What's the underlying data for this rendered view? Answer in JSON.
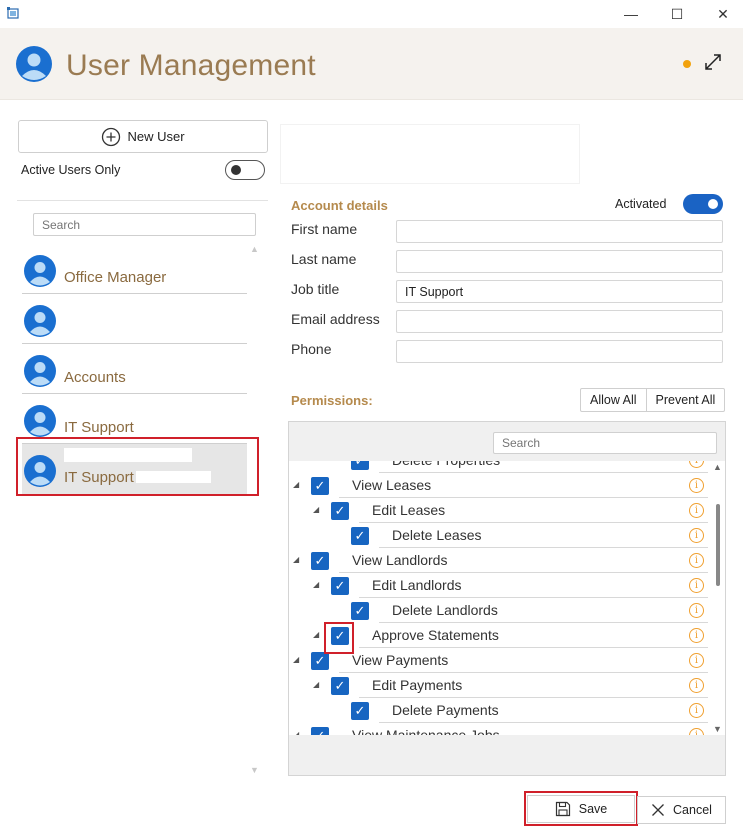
{
  "window": {
    "icon": "app-window-icon",
    "minimize": "—",
    "maximize": "☐",
    "close": "✕"
  },
  "header": {
    "title": "User Management",
    "status_color": "#f2a20c"
  },
  "left": {
    "new_user_label": "New User",
    "active_only_label": "Active Users Only",
    "search_placeholder": "Search",
    "users": [
      {
        "role": "Office Manager"
      },
      {
        "role": ""
      },
      {
        "role": "Accounts"
      },
      {
        "role": "IT Support"
      },
      {
        "role": "IT Support",
        "selected": true
      }
    ]
  },
  "account": {
    "section_title": "Account details",
    "activated_label": "Activated",
    "fields": [
      {
        "label": "First name",
        "value": ""
      },
      {
        "label": "Last name",
        "value": ""
      },
      {
        "label": "Job title",
        "value": "IT Support"
      },
      {
        "label": "Email address",
        "value": ""
      },
      {
        "label": "Phone",
        "value": ""
      }
    ]
  },
  "permissions": {
    "title": "Permissions:",
    "allow_all": "Allow All",
    "prevent_all": "Prevent All",
    "search_placeholder": "Search",
    "items": [
      {
        "label": "Delete Properties",
        "level": 2,
        "checked": true
      },
      {
        "label": "View Leases",
        "level": 0,
        "checked": true
      },
      {
        "label": "Edit Leases",
        "level": 1,
        "checked": true
      },
      {
        "label": "Delete Leases",
        "level": 2,
        "checked": true
      },
      {
        "label": "View Landlords",
        "level": 0,
        "checked": true
      },
      {
        "label": "Edit Landlords",
        "level": 1,
        "checked": true
      },
      {
        "label": "Delete Landlords",
        "level": 2,
        "checked": true
      },
      {
        "label": "Approve Statements",
        "level": 1,
        "checked": true
      },
      {
        "label": "View Payments",
        "level": 0,
        "checked": true
      },
      {
        "label": "Edit Payments",
        "level": 1,
        "checked": true
      },
      {
        "label": "Delete Payments",
        "level": 2,
        "checked": true
      },
      {
        "label": "View Maintenance Jobs",
        "level": 0,
        "checked": true
      }
    ],
    "info_glyph": "i"
  },
  "footer": {
    "save_label": "Save",
    "cancel_label": "Cancel"
  },
  "colors": {
    "accent": "#1a63c4",
    "title_brown": "#9a7b52",
    "section_gold": "#b58a4d",
    "highlight_red": "#d0202a"
  }
}
